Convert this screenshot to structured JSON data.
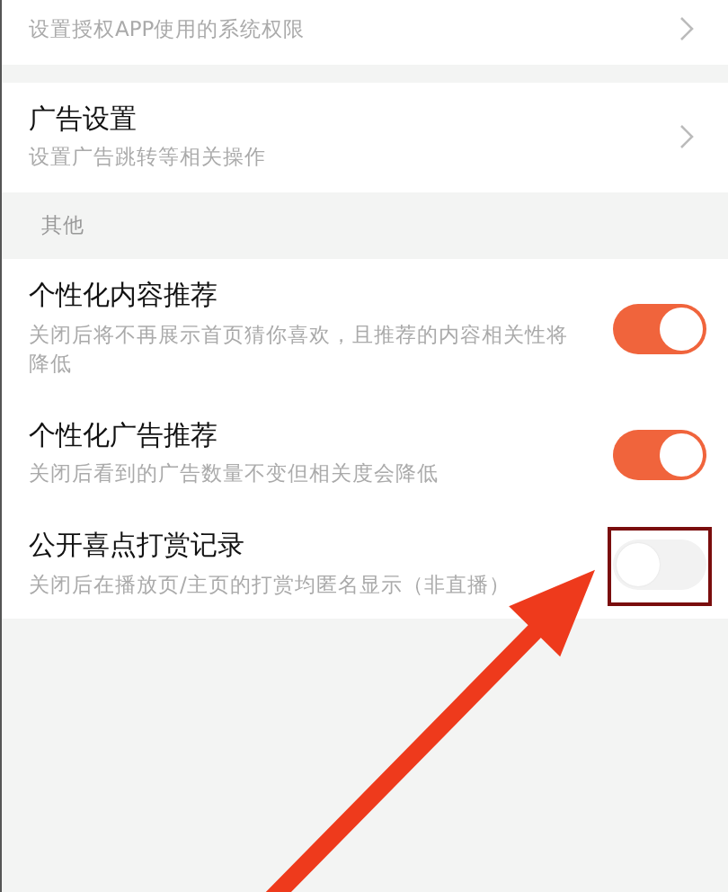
{
  "groups": [
    {
      "items": [
        {
          "kind": "link",
          "subtitle": "设置授权APP使用的系统权限"
        }
      ]
    },
    {
      "items": [
        {
          "kind": "link",
          "title": "广告设置",
          "subtitle": "设置广告跳转等相关操作"
        }
      ]
    },
    {
      "header": "其他",
      "items": [
        {
          "kind": "toggle",
          "title": "个性化内容推荐",
          "subtitle": "关闭后将不再展示首页猜你喜欢，且推荐的内容相关性将降低",
          "on": true,
          "highlighted": false
        },
        {
          "kind": "toggle",
          "title": "个性化广告推荐",
          "subtitle": "关闭后看到的广告数量不变但相关度会降低",
          "on": true,
          "highlighted": false
        },
        {
          "kind": "toggle",
          "title": "公开喜点打赏记录",
          "subtitle": "关闭后在播放页/主页的打赏均匿名显示（非直播）",
          "on": false,
          "highlighted": true
        }
      ]
    }
  ]
}
